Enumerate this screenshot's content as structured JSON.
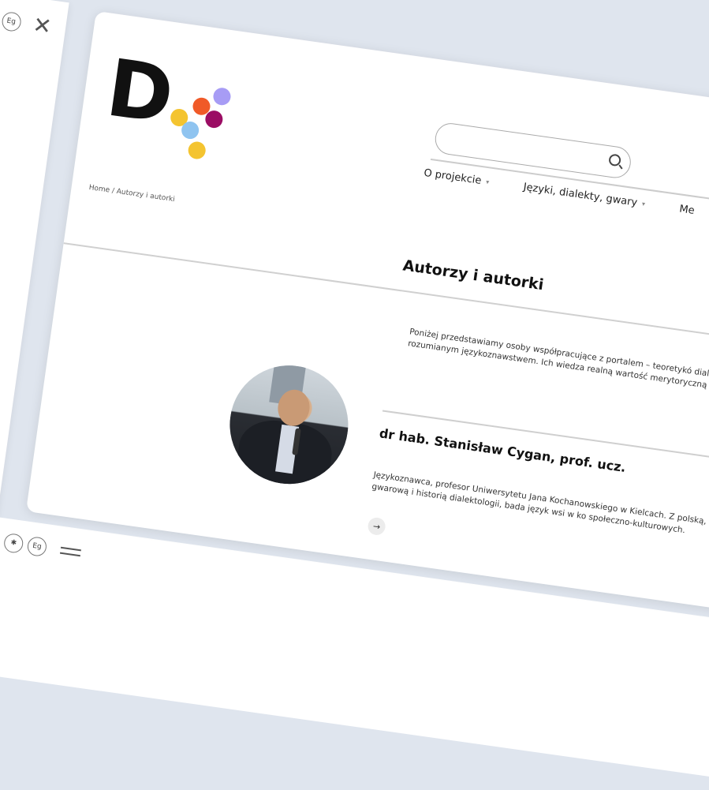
{
  "site": {
    "logo_letter": "D",
    "logo_dot_colors": [
      "#f4c430",
      "#f05a28",
      "#a79cf5",
      "#9b0d64",
      "#8fc4f0",
      "#f4c430"
    ]
  },
  "search": {
    "placeholder": ""
  },
  "nav": {
    "items": [
      {
        "label": "O projekcie"
      },
      {
        "label": "Języki, dialekty, gwary"
      },
      {
        "label": "Me"
      }
    ]
  },
  "breadcrumb": "Home / Autorzy i autorki",
  "page_title": "Autorzy i autorki",
  "intro_text": "Poniżej przedstawiamy osoby współpracujące z portalem – teoretykó dialektologią oraz szeroko rozumianym językoznawstwem. Ich wiedza realną wartość merytoryczną do publikowanych treści.",
  "author": {
    "name": "dr hab. Stanisław Cygan, prof. ucz.",
    "description": "Językoznawca, profesor Uniwersytetu Jana Kochanowskiego w Kielcach. Z polską, leksykografią gwarową i historią dialektologii, bada język wsi w ko społeczno-kulturowych.",
    "more_icon": "→"
  },
  "left_window": {
    "tools": [
      "ⓘ",
      "Eg"
    ],
    "close_icon": "✕"
  },
  "bottom_window": {
    "tools": [
      "◐",
      "✱",
      "Eg"
    ]
  }
}
